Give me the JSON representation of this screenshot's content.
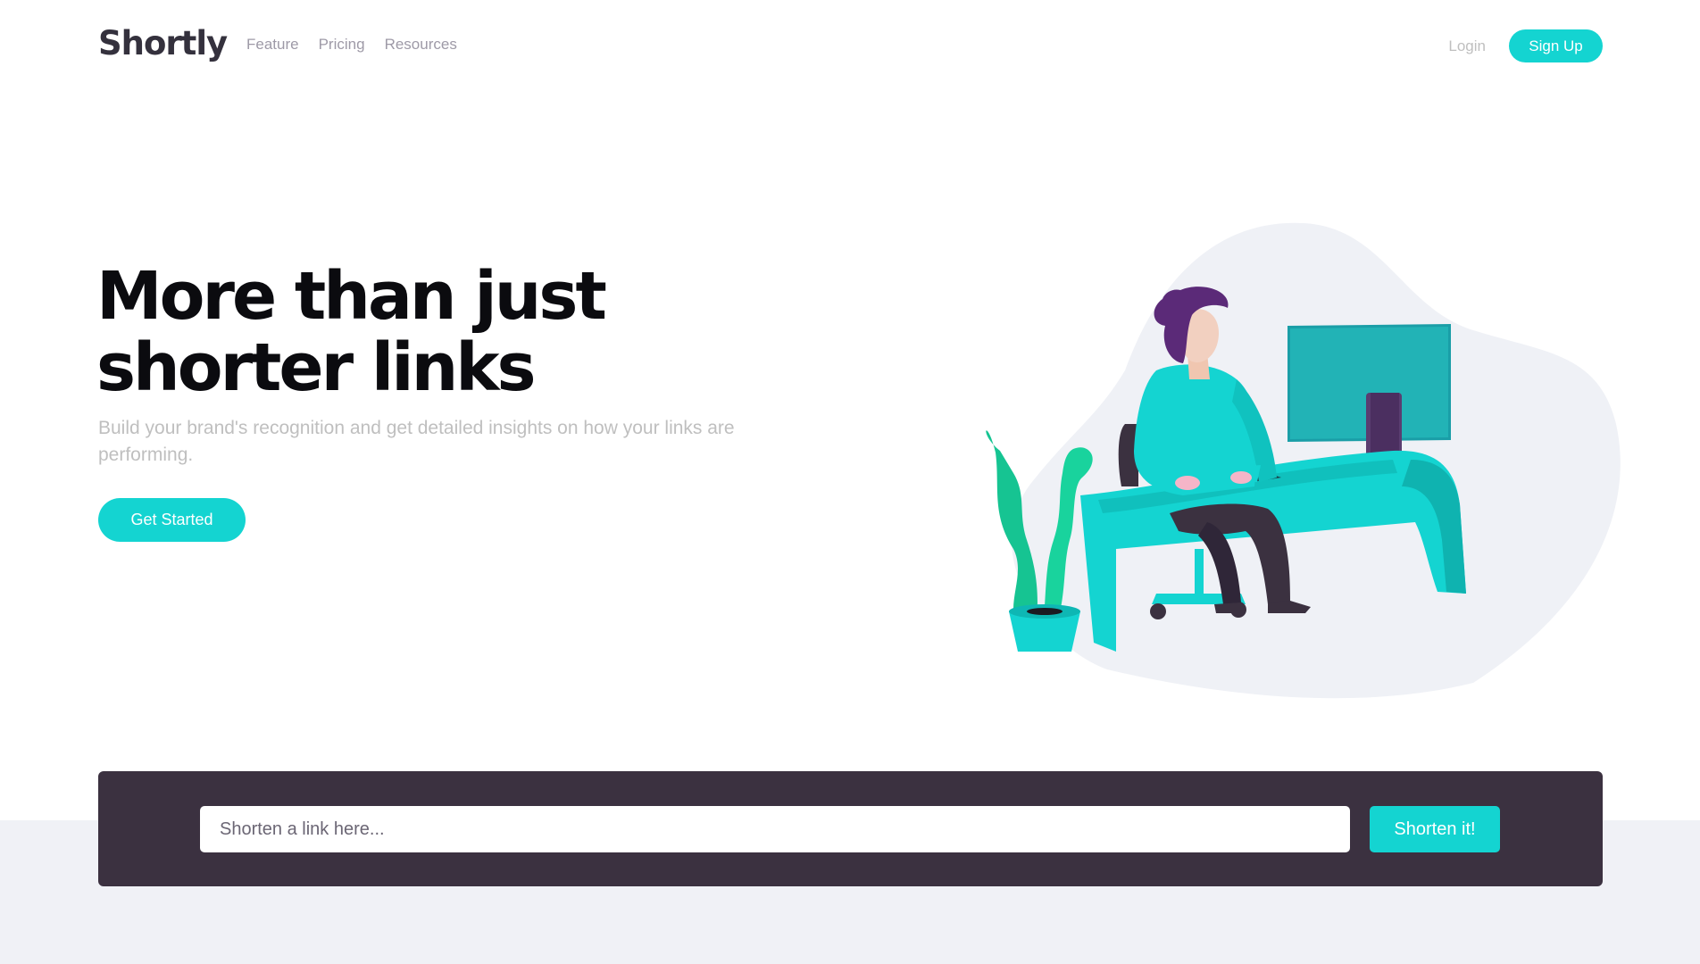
{
  "brand": {
    "logo_text": "Shortly",
    "accent_color": "#14d4d1",
    "dark_color": "#3b3140"
  },
  "nav": {
    "links": [
      "Feature",
      "Pricing",
      "Resources"
    ],
    "login_label": "Login",
    "signup_label": "Sign Up"
  },
  "hero": {
    "title": "More than just shorter links",
    "subtitle": "Build your brand's recognition and get detailed insights on how your links are performing.",
    "cta_label": "Get Started",
    "illustration": "person-working-at-desk-illustration"
  },
  "shortener": {
    "placeholder": "Shorten a link here...",
    "value": "",
    "button_label": "Shorten it!"
  }
}
